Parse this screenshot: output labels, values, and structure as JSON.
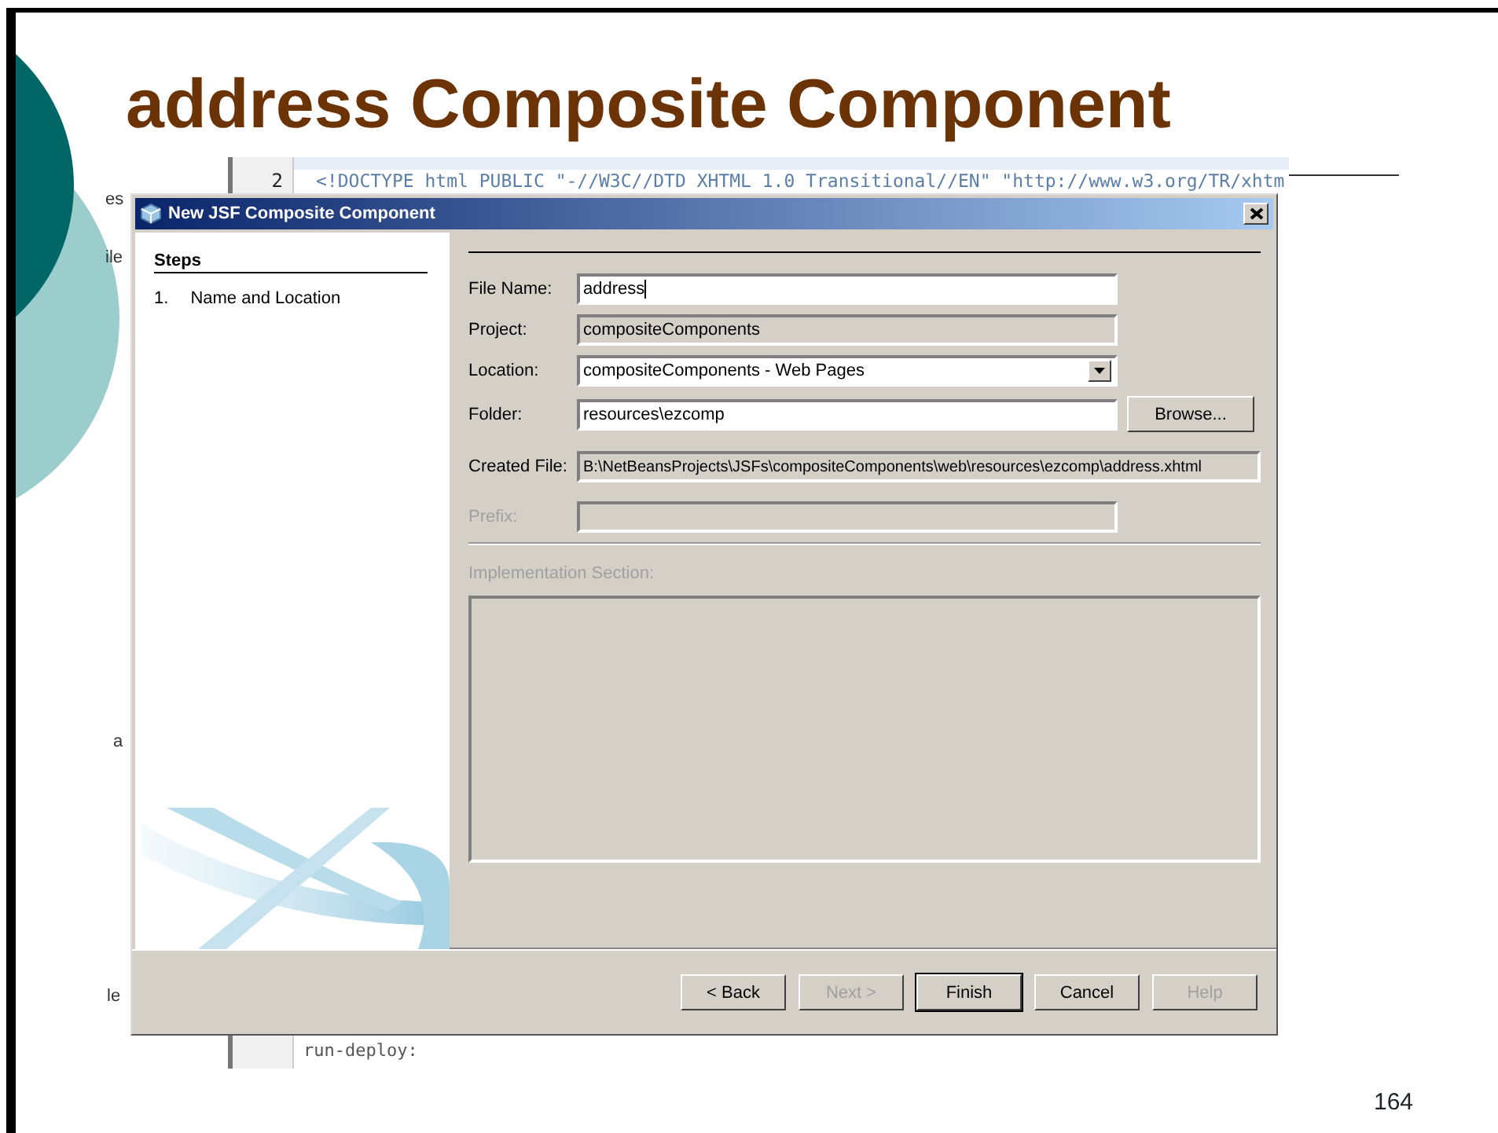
{
  "slide": {
    "title": "address Composite Component",
    "page_number": "164"
  },
  "background_editor": {
    "line_number": "2",
    "code_line": "<!DOCTYPE html PUBLIC \"-//W3C//DTD XHTML 1.0 Transitional//EN\" \"http://www.w3.org/TR/xhtm",
    "output_line": "run-deploy:",
    "fragments": [
      "es",
      "ile",
      "a",
      "le"
    ]
  },
  "dialog": {
    "title": "New JSF Composite Component",
    "steps_heading": "Steps",
    "steps": [
      {
        "number": "1.",
        "label": "Name and Location"
      }
    ],
    "fields": [
      {
        "kind": "input",
        "label": "File Name:",
        "value": "address",
        "disabled": false
      },
      {
        "kind": "readonly",
        "label": "Project:",
        "value": "compositeComponents",
        "disabled": false
      },
      {
        "kind": "select",
        "label": "Location:",
        "value": "compositeComponents - Web Pages",
        "disabled": false
      },
      {
        "kind": "browse",
        "label": "Folder:",
        "value": "resources\\ezcomp",
        "button": "Browse...",
        "disabled": false
      },
      {
        "kind": "readonly",
        "label": "Created File:",
        "value": "B:\\NetBeansProjects\\JSFs\\compositeComponents\\web\\resources\\ezcomp\\address.xhtml",
        "disabled": false
      },
      {
        "kind": "input",
        "label": "Prefix:",
        "disabled": true
      }
    ],
    "implementation_label": "Implementation Section:",
    "implementation_disabled": true,
    "buttons": [
      {
        "label": "< Back",
        "disabled": false,
        "default": false
      },
      {
        "label": "Next >",
        "disabled": true,
        "default": false
      },
      {
        "label": "Finish",
        "disabled": false,
        "default": true
      },
      {
        "label": "Cancel",
        "disabled": false,
        "default": false
      },
      {
        "label": "Help",
        "disabled": true,
        "default": false
      }
    ]
  }
}
